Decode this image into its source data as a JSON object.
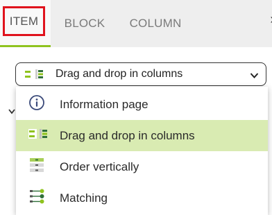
{
  "tabs": {
    "item_label": "ITEM",
    "block_label": "BLOCK",
    "column_label": "COLUMN",
    "more_glyph": "›"
  },
  "select": {
    "value": "Drag and drop in columns",
    "icon": "columns-icon",
    "chevron": "chevron-down-icon"
  },
  "options": [
    {
      "label": "Information page",
      "icon": "info-circle-icon"
    },
    {
      "label": "Drag and drop in columns",
      "icon": "columns-icon",
      "selected": true
    },
    {
      "label": "Order vertically",
      "icon": "order-list-icon"
    },
    {
      "label": "Matching",
      "icon": "matching-icon"
    }
  ],
  "colors": {
    "accent_green": "#8fc31f",
    "highlight": "#d9ebb2",
    "focus_red": "#e0131d"
  }
}
